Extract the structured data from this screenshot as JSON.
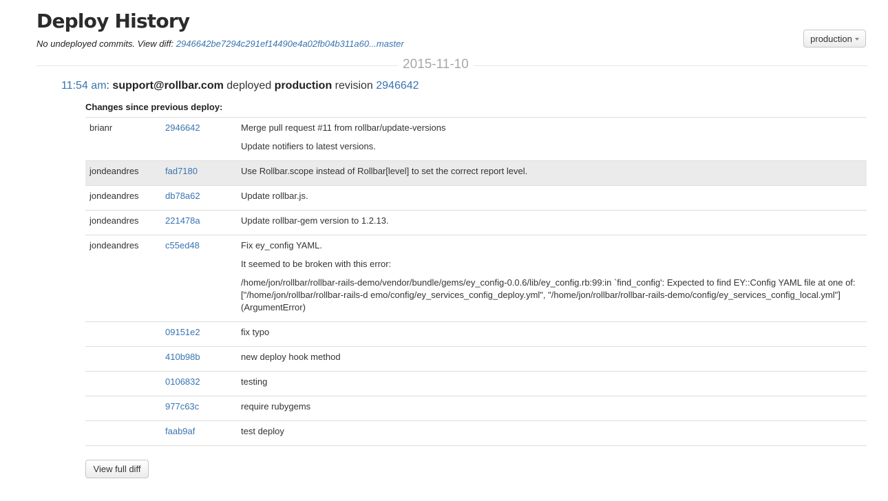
{
  "page": {
    "title": "Deploy History",
    "subtitle_prefix": "No undeployed commits. View diff: ",
    "diff_link": "2946642be7294c291ef14490e4a02fb04b311a60...master"
  },
  "environment_dropdown": {
    "selected": "production"
  },
  "date_label": "2015-11-10",
  "deploy": {
    "time": "11:54 am",
    "sep": ": ",
    "user": "support@rollbar.com",
    "verb": " deployed ",
    "environment": "production",
    "revision_word": " revision ",
    "revision": "2946642"
  },
  "changes_title": "Changes since previous deploy:",
  "commits": [
    {
      "author": "brianr",
      "sha": "2946642",
      "lines": [
        "Merge pull request #11 from rollbar/update-versions",
        "Update notifiers to latest versions."
      ],
      "highlight": false
    },
    {
      "author": "jondeandres",
      "sha": "fad7180",
      "lines": [
        "Use Rollbar.scope instead of Rollbar[level] to set the correct report level."
      ],
      "highlight": true
    },
    {
      "author": "jondeandres",
      "sha": "db78a62",
      "lines": [
        "Update rollbar.js."
      ],
      "highlight": false
    },
    {
      "author": "jondeandres",
      "sha": "221478a",
      "lines": [
        "Update rollbar-gem version to 1.2.13."
      ],
      "highlight": false
    },
    {
      "author": "jondeandres",
      "sha": "c55ed48",
      "lines": [
        "Fix ey_config YAML.",
        "It seemed to be broken with this error:",
        "/home/jon/rollbar/rollbar-rails-demo/vendor/bundle/gems/ey_config-0.0.6/lib/ey_config.rb:99:in `find_config': Expected to find EY::Config YAML file at one of: [\"/home/jon/rollbar/rollbar-rails-d emo/config/ey_services_config_deploy.yml\", \"/home/jon/rollbar/rollbar-rails-demo/config/ey_services_config_local.yml\"] (ArgumentError)"
      ],
      "highlight": false
    },
    {
      "author": "",
      "sha": "09151e2",
      "lines": [
        "fix typo"
      ],
      "highlight": false
    },
    {
      "author": "",
      "sha": "410b98b",
      "lines": [
        "new deploy hook method"
      ],
      "highlight": false
    },
    {
      "author": "",
      "sha": "0106832",
      "lines": [
        "testing"
      ],
      "highlight": false
    },
    {
      "author": "",
      "sha": "977c63c",
      "lines": [
        "require rubygems"
      ],
      "highlight": false
    },
    {
      "author": "",
      "sha": "faab9af",
      "lines": [
        "test deploy"
      ],
      "highlight": false
    }
  ],
  "view_full_diff_label": "View full diff",
  "colors": {
    "link": "#3874b1",
    "highlight_row": "#ebebeb",
    "date": "#a8a8a8"
  }
}
